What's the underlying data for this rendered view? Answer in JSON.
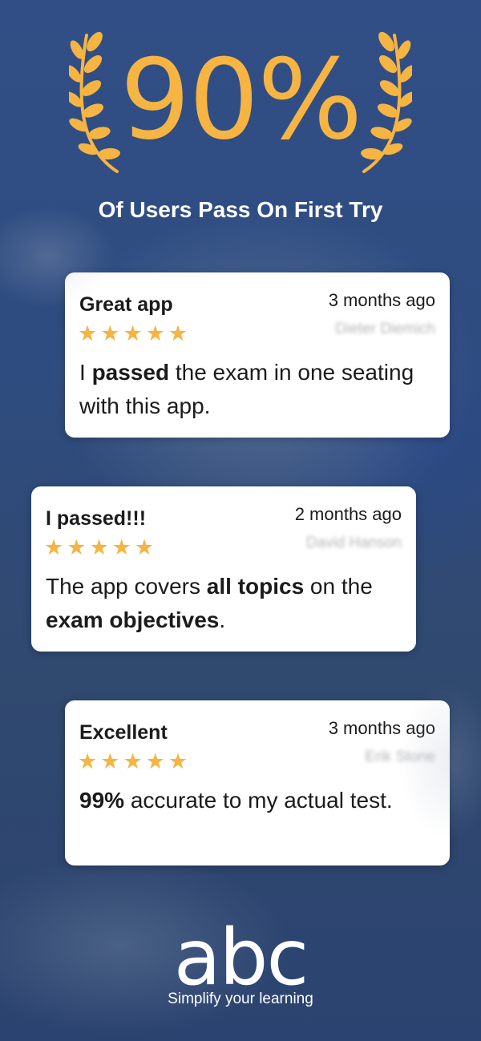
{
  "colors": {
    "accent": "#f6b443",
    "background": "#30496f",
    "card": "#ffffff",
    "text": "#1b1b1b"
  },
  "headline": {
    "number": "90%",
    "subtitle": "Of Users Pass On First Try"
  },
  "reviews": [
    {
      "title": "Great app",
      "date": "3 months ago",
      "reviewer": "Dieter Diemich",
      "rating": 5,
      "body": [
        {
          "text": "I ",
          "bold": false
        },
        {
          "text": "passed",
          "bold": true
        },
        {
          "text": " the exam in one seating with this app.",
          "bold": false
        }
      ]
    },
    {
      "title": "I passed!!!",
      "date": "2 months ago",
      "reviewer": "David Hanson",
      "rating": 5,
      "body": [
        {
          "text": "The app covers ",
          "bold": false
        },
        {
          "text": "all topics",
          "bold": true
        },
        {
          "text": " on the ",
          "bold": false
        },
        {
          "text": "exam objectives",
          "bold": true
        },
        {
          "text": ".",
          "bold": false
        }
      ]
    },
    {
      "title": "Excellent",
      "date": "3 months ago",
      "reviewer": "Erik Stone",
      "rating": 5,
      "body": [
        {
          "text": "99%",
          "bold": true
        },
        {
          "text": " accurate to my actual test.",
          "bold": false
        }
      ]
    }
  ],
  "brand": {
    "logo_text": "abc",
    "tagline": "Simplify your learning"
  }
}
